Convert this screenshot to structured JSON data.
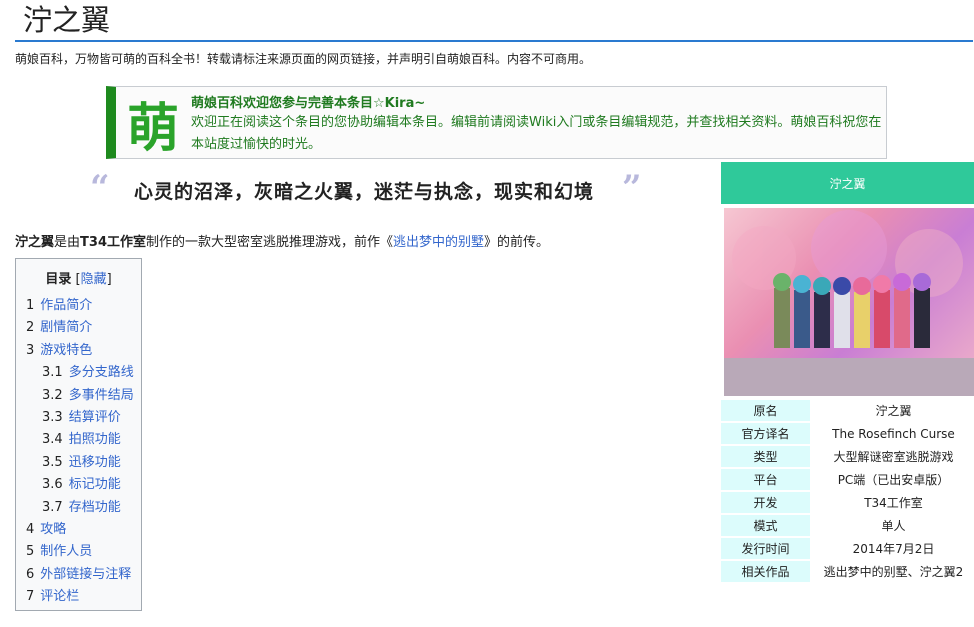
{
  "page": {
    "title": "泞之翼",
    "subtitle": "萌娘百科，万物皆可萌的百科全书！转载请标注来源页面的网页链接，并声明引自萌娘百科。内容不可商用。"
  },
  "notice": {
    "logo_char": "萌",
    "title": "萌娘百科欢迎您参与完善本条目☆Kira~",
    "body_before": "欢迎正在阅读这个条目的您协助",
    "link_edit": "编辑本条目",
    "body_mid1": "。编辑前请阅读",
    "link_wiki": "Wiki入门",
    "body_mid2": "或",
    "link_rules": "条目编辑规范",
    "body_after": "，并查找相关资料。萌娘百科祝您在本站度过愉快的时光。",
    "accent": "#1e8a1e"
  },
  "quote": {
    "open": "“",
    "text": "心灵的沼泽，灰暗之火翼，迷茫与执念，现实和幻境",
    "close": "”"
  },
  "intro": {
    "bold_title": "泞之翼",
    "part1": "是由",
    "bold_studio": "T34工作室",
    "part2": "制作的一款大型密室逃脱推理游戏，前作《",
    "link_prequel": "逃出梦中的别墅",
    "part3": "》的前传。"
  },
  "toc": {
    "heading": "目录",
    "hide_open": " [",
    "hide_label": "隐藏",
    "hide_close": "]",
    "items": [
      {
        "num": "1",
        "text": "作品简介",
        "level": 1
      },
      {
        "num": "2",
        "text": "剧情简介",
        "level": 1
      },
      {
        "num": "3",
        "text": "游戏特色",
        "level": 1
      },
      {
        "num": "3.1",
        "text": "多分支路线",
        "level": 2
      },
      {
        "num": "3.2",
        "text": "多事件结局",
        "level": 2
      },
      {
        "num": "3.3",
        "text": "结算评价",
        "level": 2
      },
      {
        "num": "3.4",
        "text": "拍照功能",
        "level": 2
      },
      {
        "num": "3.5",
        "text": "迅移功能",
        "level": 2
      },
      {
        "num": "3.6",
        "text": "标记功能",
        "level": 2
      },
      {
        "num": "3.7",
        "text": "存档功能",
        "level": 2
      },
      {
        "num": "4",
        "text": "攻略",
        "level": 1
      },
      {
        "num": "5",
        "text": "制作人员",
        "level": 1
      },
      {
        "num": "6",
        "text": "外部链接与注释",
        "level": 1
      },
      {
        "num": "7",
        "text": "评论栏",
        "level": 1
      }
    ]
  },
  "infobox": {
    "title": "泞之翼",
    "header_color": "#2fc99a",
    "label_bg": "#dcfcfc",
    "rows": [
      {
        "label": "原名",
        "value": "泞之翼"
      },
      {
        "label": "官方译名",
        "value": "The Rosefinch Curse"
      },
      {
        "label": "类型",
        "value": "大型解谜密室逃脱游戏"
      },
      {
        "label": "平台",
        "value": "PC端（已出安卓版）"
      },
      {
        "label": "开发",
        "value": "T34工作室"
      },
      {
        "label": "模式",
        "value": "单人"
      },
      {
        "label": "发行时间",
        "value": "2014年7月2日"
      },
      {
        "label": "相关作品",
        "value": "逃出梦中的别墅、泞之翼2",
        "is_link": true
      }
    ]
  }
}
